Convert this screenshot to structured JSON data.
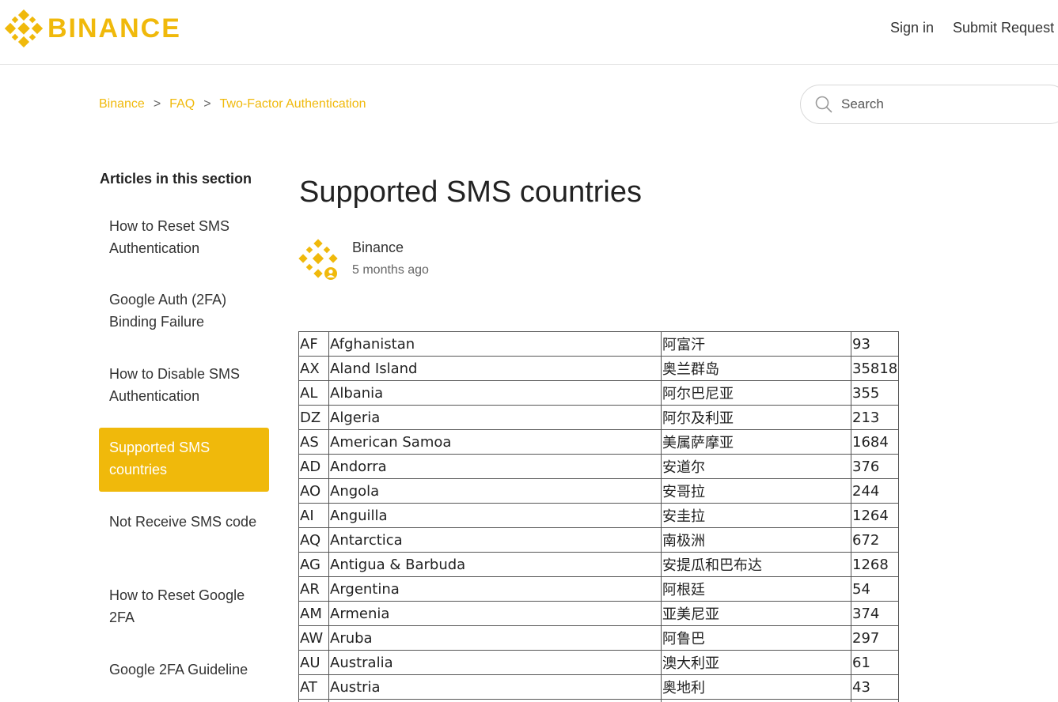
{
  "brand": {
    "name": "BINANCE",
    "color": "#f0b90b"
  },
  "header": {
    "sign_in": "Sign in",
    "submit_request": "Submit Request"
  },
  "breadcrumb": [
    "Binance",
    "FAQ",
    "Two-Factor Authentication"
  ],
  "breadcrumb_separator": ">",
  "search": {
    "placeholder": "Search",
    "icon": "search-icon"
  },
  "sidebar": {
    "title": "Articles in this section",
    "items": [
      {
        "label": "How to Reset SMS Authentication",
        "active": false
      },
      {
        "label": "Google Auth (2FA) Binding Failure",
        "active": false
      },
      {
        "label": "How to Disable SMS Authentication",
        "active": false
      },
      {
        "label": "Supported SMS countries",
        "active": true
      },
      {
        "label": "Not Receive SMS code",
        "active": false
      },
      {
        "label": "How to Reset Google 2FA",
        "active": false
      },
      {
        "label": "Google 2FA Guideline",
        "active": false
      }
    ]
  },
  "article": {
    "title": "Supported SMS countries",
    "author": "Binance",
    "updated": "5 months ago"
  },
  "table": {
    "rows": [
      [
        "AF",
        "Afghanistan",
        "阿富汗",
        "93"
      ],
      [
        "AX",
        "Aland Island",
        "奥兰群岛",
        "35818"
      ],
      [
        "AL",
        "Albania",
        "阿尔巴尼亚",
        "355"
      ],
      [
        "DZ",
        "Algeria",
        "阿尔及利亚",
        "213"
      ],
      [
        "AS",
        "American Samoa",
        "美属萨摩亚",
        "1684"
      ],
      [
        "AD",
        "Andorra",
        "安道尔",
        "376"
      ],
      [
        "AO",
        "Angola",
        "安哥拉",
        "244"
      ],
      [
        "AI",
        "Anguilla",
        "安圭拉",
        "1264"
      ],
      [
        "AQ",
        "Antarctica",
        "南极洲",
        "672"
      ],
      [
        "AG",
        "Antigua & Barbuda",
        "安提瓜和巴布达",
        "1268"
      ],
      [
        "AR",
        "Argentina",
        "阿根廷",
        "54"
      ],
      [
        "AM",
        "Armenia",
        "亚美尼亚",
        "374"
      ],
      [
        "AW",
        "Aruba",
        "阿鲁巴",
        "297"
      ],
      [
        "AU",
        "Australia",
        "澳大利亚",
        "61"
      ],
      [
        "AT",
        "Austria",
        "奥地利",
        "43"
      ],
      [
        "",
        "",
        "",
        ""
      ]
    ]
  }
}
